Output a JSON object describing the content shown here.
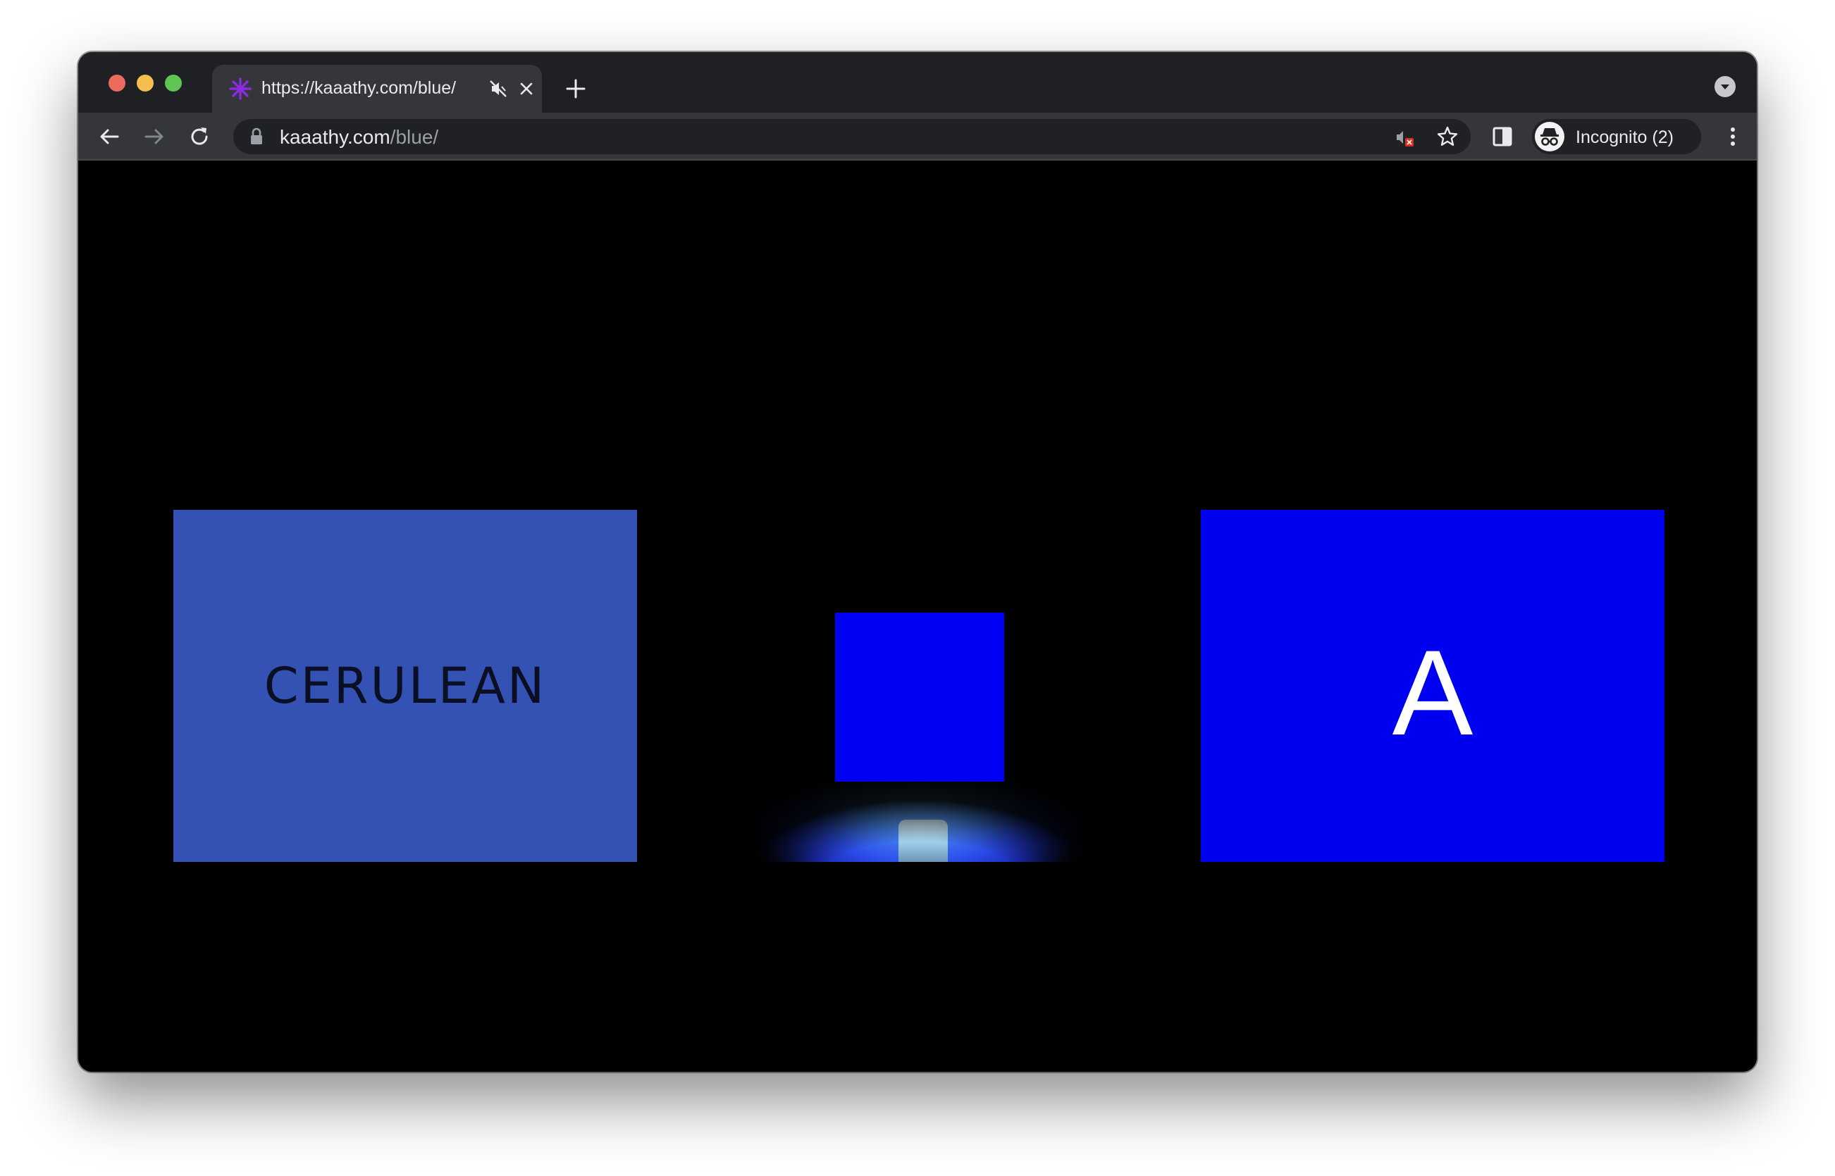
{
  "browser": {
    "tab": {
      "title": "https://kaaathy.com/blue/",
      "favicon": "asterisk-icon",
      "favicon_color": "#8a2be2"
    },
    "address_bar": {
      "host": "kaaathy.com",
      "path": "/blue/"
    },
    "profile": {
      "label": "Incognito (2)"
    }
  },
  "page": {
    "panels": [
      {
        "kind": "word",
        "text": "CERULEAN",
        "background": "#3452b4"
      },
      {
        "kind": "photo",
        "subject": "led-light-with-blue-square",
        "square_color": "#0000f5"
      },
      {
        "kind": "letter",
        "text": "A",
        "background": "#0000f0"
      }
    ],
    "background": "#000000"
  }
}
